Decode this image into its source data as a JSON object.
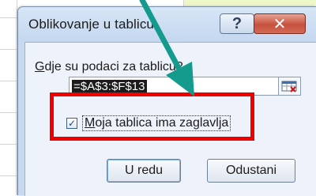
{
  "dialog": {
    "title": "Oblikovanje u tablicu",
    "help_button": "?",
    "close_button": "✕",
    "range_label_accel": "G",
    "range_label_rest": "dje su podaci za tablicu?",
    "range_value": "=$A$3:$F$13",
    "checkbox": {
      "checked": true,
      "mark": "✓",
      "label_accel": "M",
      "label_rest": "oja tablica ima zaglavlja"
    },
    "ok_button": "U redu",
    "cancel_button": "Odustani"
  },
  "annotations": {
    "highlight_color": "#ee0000",
    "arrow_color": "#159a8e"
  },
  "sheet": {
    "fill_color": "#eef7c8"
  }
}
